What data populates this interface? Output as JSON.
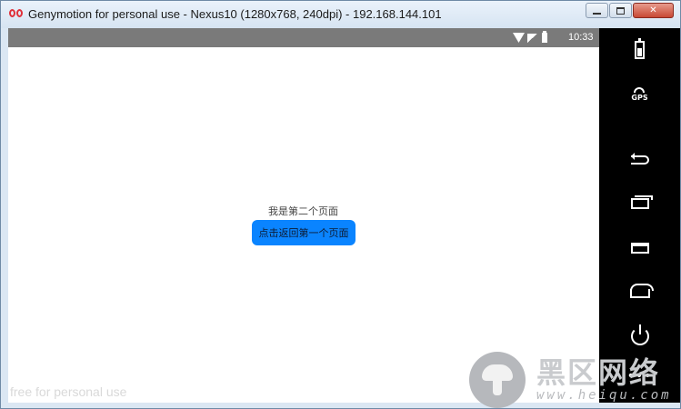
{
  "window": {
    "title": "Genymotion for personal use - Nexus10 (1280x768, 240dpi) - 192.168.144.101",
    "minimize_glyph": "",
    "maximize_glyph": "",
    "close_glyph": "✕"
  },
  "statusbar": {
    "time": "10:33"
  },
  "app": {
    "page_label": "我是第二个页面",
    "back_button_label": "点击返回第一个页面",
    "button_color": "#0a84ff"
  },
  "watermark": "free for personal use",
  "side_panel": {
    "gps_label": "GPS",
    "more_glyph": "•••",
    "icons": [
      "battery-icon",
      "gps-icon",
      "back-icon",
      "recent-apps-icon",
      "menu-icon",
      "home-icon",
      "power-icon",
      "more-icon"
    ]
  },
  "logo": {
    "title": "黑区网络",
    "url": "www.heiqu.com"
  }
}
